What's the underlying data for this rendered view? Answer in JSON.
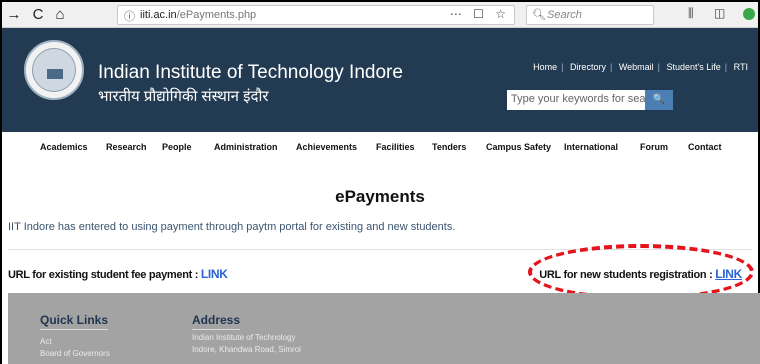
{
  "browser": {
    "back": "→",
    "reload": "C",
    "home": "⌂",
    "url_domain": "iiti.ac.in",
    "url_path": "/ePayments.php",
    "url_actions": "⋯ ☐ ☆",
    "search_placeholder": "Search"
  },
  "site": {
    "title_en": "Indian Institute of Technology Indore",
    "title_hi": "भारतीय प्रौद्योगिकी संस्थान इंदौर",
    "top_links": [
      "Home",
      "Directory",
      "Webmail",
      "Student's Life",
      "RTI"
    ],
    "keyword_placeholder": "Type your keywords for search",
    "keyword_button": "🔍"
  },
  "mainnav": [
    "Academics",
    "Research",
    "People",
    "Administration",
    "Achievements",
    "Facilities",
    "Tenders",
    "Campus Safety",
    "International",
    "Forum",
    "Contact"
  ],
  "content": {
    "title": "ePayments",
    "intro": "IIT Indore has entered to using payment through paytm portal for existing and new students.",
    "existing_label": "URL for existing student fee payment : ",
    "existing_link": "LINK",
    "new_label": "URL for new students registration : ",
    "new_link": "LINK"
  },
  "footer": {
    "quick_links_title": "Quick Links",
    "quick_links": [
      "Act",
      "Board of Governors"
    ],
    "address_title": "Address",
    "address_lines": [
      "Indian Institute of Technology",
      "Indore, Khandwa Road, Simrol"
    ]
  },
  "colors": {
    "header_bg": "#233b52",
    "link_blue": "#2b63d4",
    "annotation_red": "#e3141b",
    "footer_bg": "#a3a3a3"
  }
}
